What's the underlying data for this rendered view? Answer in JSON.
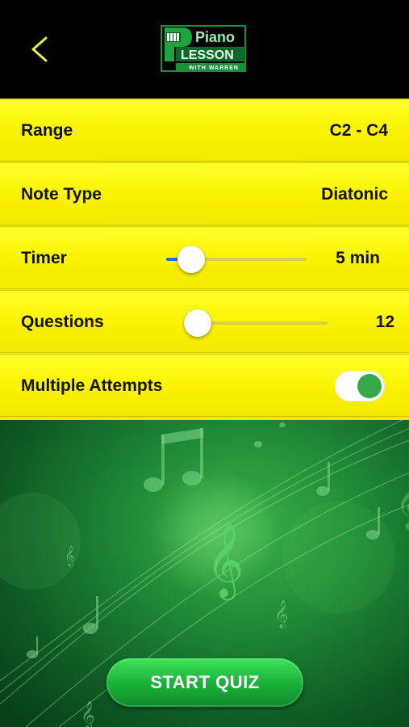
{
  "header": {
    "back_icon": "chevron-left-icon",
    "logo": {
      "line1": "Piano",
      "line2": "LESSON",
      "line3": "WITH WARREN"
    }
  },
  "settings": {
    "range": {
      "label": "Range",
      "value": "C2 - C4"
    },
    "note_type": {
      "label": "Note Type",
      "value": "Diatonic"
    },
    "timer": {
      "label": "Timer",
      "value": "5 min",
      "slider_fraction": 0.1
    },
    "questions": {
      "label": "Questions",
      "value": "12",
      "slider_fraction": 0.0
    },
    "multiple_attempts": {
      "label": "Multiple Attempts",
      "enabled": true
    }
  },
  "start_button": {
    "label": "START QUIZ"
  },
  "colors": {
    "settings_background": "#f6ee00",
    "header_background": "#000000",
    "accent_green": "#37a84a",
    "slider_blue": "#1a78d6",
    "back_arrow": "#e9ee3a"
  }
}
